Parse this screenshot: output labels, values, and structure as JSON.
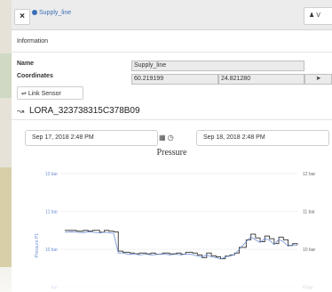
{
  "window": {
    "tab_label": "Supply_line",
    "close_label": "×",
    "right_button_label": "V"
  },
  "info": {
    "header": "Information",
    "name_label": "Name",
    "name_value": "Supply_line",
    "coords_label": "Coordinates",
    "lat": "60.219199",
    "lon": "24.821280",
    "locate_icon": "➤"
  },
  "link_sensor_label": "Link Sensor",
  "sensor": {
    "icon": "chart-line-icon",
    "title": "LORA_323738315C378B09"
  },
  "range": {
    "start": "Sep 17, 2018 2:48 PM",
    "end": "Sep 18, 2018 2:48 PM"
  },
  "chart_data": {
    "type": "line",
    "title": "Pressure",
    "ylabel": "Pressure P1",
    "ylim": [
      9,
      12
    ],
    "y_ticks_left": [
      "12 bar",
      "11 bar",
      "10 bar",
      "bar"
    ],
    "y_ticks_right": [
      "12 bar",
      "11 bar",
      "10 bar",
      "9 bar"
    ],
    "grid": true,
    "x": [
      0,
      3,
      5,
      8,
      10,
      12,
      15,
      17,
      19,
      21,
      23,
      25,
      28,
      30,
      32,
      35,
      37,
      39,
      42,
      45,
      48,
      50,
      52,
      55,
      57,
      59,
      61,
      63,
      65,
      67,
      69,
      71,
      73,
      75,
      78,
      80,
      82,
      84,
      86,
      88,
      90,
      92,
      94,
      96,
      98,
      100
    ],
    "series": [
      {
        "values": [
          10.5,
          10.5,
          10.48,
          10.5,
          10.48,
          10.5,
          10.45,
          10.5,
          10.48,
          10.46,
          9.95,
          9.92,
          9.9,
          9.88,
          9.9,
          9.88,
          9.9,
          9.87,
          9.9,
          9.88,
          9.9,
          9.87,
          9.92,
          9.9,
          9.85,
          9.78,
          9.9,
          9.83,
          9.8,
          9.75,
          9.82,
          9.85,
          9.9,
          10.05,
          10.25,
          10.4,
          10.3,
          10.2,
          10.35,
          10.28,
          10.15,
          10.32,
          10.25,
          10.1,
          10.15,
          10.12
        ],
        "color": "#444444"
      },
      {
        "values": [
          10.45,
          10.46,
          10.45,
          10.44,
          10.46,
          10.45,
          10.43,
          10.45,
          10.44,
          10.42,
          9.9,
          9.9,
          9.86,
          9.88,
          9.85,
          9.87,
          9.85,
          9.86,
          9.88,
          9.85,
          9.87,
          9.85,
          9.88,
          9.86,
          9.82,
          9.8,
          9.85,
          9.8,
          9.78,
          9.74,
          9.8,
          9.82,
          9.86,
          10.0,
          10.2,
          10.33,
          10.25,
          10.18,
          10.28,
          10.24,
          10.12,
          10.26,
          10.2,
          10.08,
          10.12,
          10.1
        ],
        "color": "#6d8ed4"
      }
    ]
  }
}
